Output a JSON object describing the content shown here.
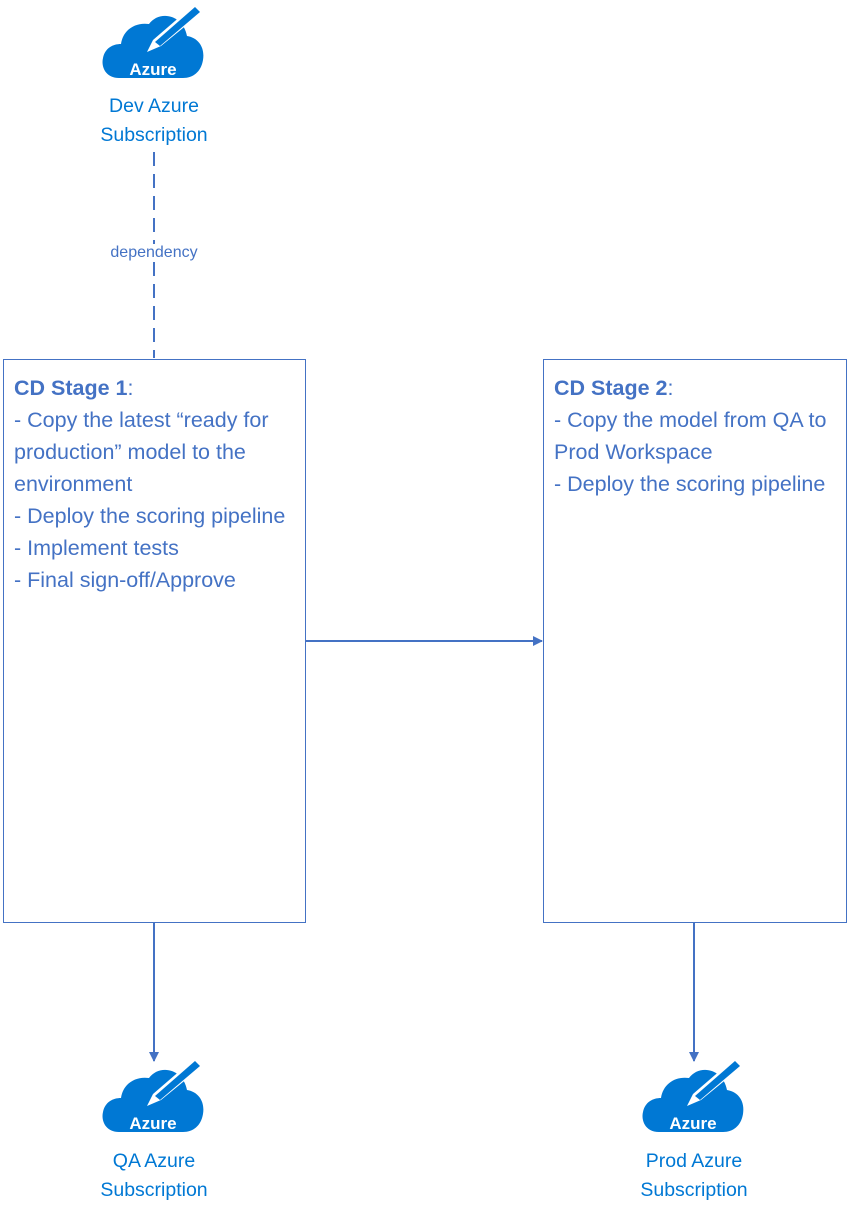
{
  "colors": {
    "box": "#4472C4",
    "azure": "#0078D4"
  },
  "dev": {
    "icon": "azure-cloud-edit-icon",
    "logo_text": "Azure",
    "label_line1": "Dev Azure",
    "label_line2": "Subscription"
  },
  "qa": {
    "icon": "azure-cloud-edit-icon",
    "logo_text": "Azure",
    "label_line1": "QA Azure",
    "label_line2": "Subscription"
  },
  "prod": {
    "icon": "azure-cloud-edit-icon",
    "logo_text": "Azure",
    "label_line1": "Prod Azure",
    "label_line2": "Subscription"
  },
  "dependency_label": "dependency",
  "stage1": {
    "title": "CD Stage 1",
    "colon": ":",
    "lines": [
      "- Copy the latest “ready for production” model to the environment",
      "- Deploy the scoring pipeline",
      "- Implement tests",
      "- Final sign-off/Approve"
    ]
  },
  "stage2": {
    "title": "CD Stage 2",
    "colon": ":",
    "lines": [
      "- Copy the model from QA to Prod Workspace",
      "- Deploy the scoring pipeline"
    ]
  }
}
